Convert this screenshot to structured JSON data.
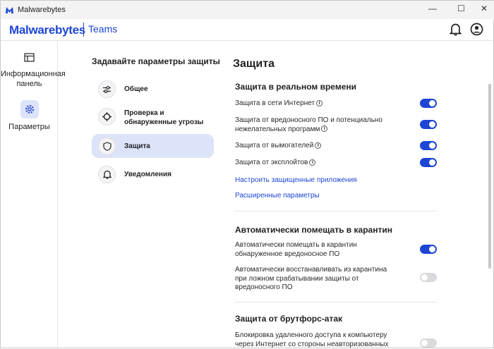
{
  "window": {
    "title": "Malwarebytes",
    "minimize": "—",
    "maximize": "☐",
    "close": "✕"
  },
  "header": {
    "brand": "Malwarebytes",
    "product": "Teams"
  },
  "rail": [
    {
      "label": "Информационная панель",
      "icon": "dashboard-icon"
    },
    {
      "label": "Параметры",
      "icon": "gear-icon"
    }
  ],
  "nav": {
    "title": "Задавайте параметры защиты",
    "items": [
      {
        "label": "Общее"
      },
      {
        "label": "Проверка и обнаруженные угрозы"
      },
      {
        "label": "Защита"
      },
      {
        "label": "Уведомления"
      }
    ]
  },
  "content": {
    "title": "Защита",
    "realtime": {
      "title": "Защита в реальном времени",
      "items": [
        {
          "label": "Защита в сети Интернет",
          "on": true
        },
        {
          "label": "Защита от вредоносного ПО и потенциально нежелательных программ",
          "on": true
        },
        {
          "label": "Защита от вымогателей",
          "on": true
        },
        {
          "label": "Защита от эксплойтов",
          "on": true
        }
      ],
      "link1": "Настроить защищенные приложения",
      "link2": "Расширенные параметры"
    },
    "quarantine": {
      "title": "Автоматически помещать в карантин",
      "items": [
        {
          "label": "Автоматически помещать в карантин обнаруженное вредоносное ПО",
          "on": true
        },
        {
          "label": "Автоматически восстанавливать из карантина при ложном срабатывании защиты от вредоносного ПО",
          "on": false
        }
      ]
    },
    "brute": {
      "title": "Защита от брутфорс-атак",
      "items": [
        {
          "label": "Блокировка удаленного доступа к компьютеру через Интернет со стороны неавторизованных",
          "on": false
        }
      ]
    }
  },
  "colors": {
    "accent": "#1d46d6"
  }
}
